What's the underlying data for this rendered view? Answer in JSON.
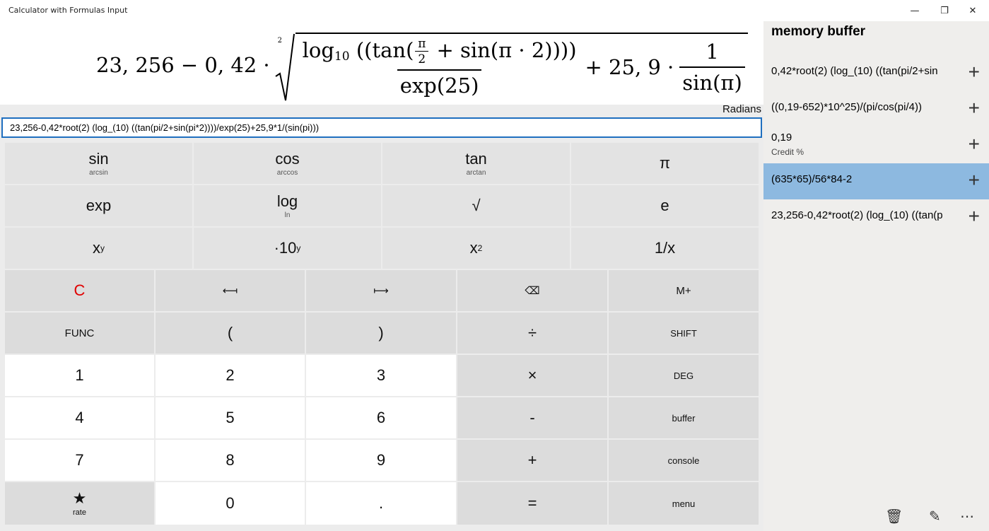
{
  "window": {
    "title": "Calculator with Formulas Input",
    "min": "—",
    "restore": "❐",
    "close": "✕"
  },
  "formula_render": {
    "a": "23, 256 − 0, 42 ·",
    "root_index": "2",
    "log": "log",
    "log_base": "10",
    "tan_part": "((tan(",
    "pi": "π",
    "two": "2",
    "sin_part": "+ sin(π · 2))))",
    "exp": "exp(25)",
    "plus": "+ 25, 9 ·",
    "one": "1",
    "sinpi": "sin(π)"
  },
  "mode": "Radians",
  "input_value": "23,256-0,42*root(2) (log_(10) ((tan(pi/2+sin(pi*2))))/exp(25)+25,9*1/(sin(pi)))",
  "keys": {
    "sin": "sin",
    "arcsin": "arcsin",
    "cos": "cos",
    "arccos": "arccos",
    "tan": "tan",
    "arctan": "arctan",
    "pi": "π",
    "exp": "exp",
    "log": "log",
    "ln": "ln",
    "sqrt": "√",
    "e": "e",
    "x": "x",
    "y": "y",
    "dot10": "·10",
    "x2": "x",
    "two": "2",
    "inv": "1/x",
    "clear": "C",
    "left": "⟻",
    "right": "⟼",
    "backspace": "⌫",
    "mplus": "M+",
    "func": "FUNC",
    "lparen": "(",
    "rparen": ")",
    "div": "÷",
    "shift": "SHIFT",
    "n1": "1",
    "n2": "2",
    "n3": "3",
    "mul": "×",
    "deg": "DEG",
    "n4": "4",
    "n5": "5",
    "n6": "6",
    "minus": "-",
    "buffer": "buffer",
    "n7": "7",
    "n8": "8",
    "n9": "9",
    "plus": "+",
    "console": "console",
    "star": "★",
    "rate": "rate",
    "n0": "0",
    "dot": ".",
    "eq": "=",
    "menu": "menu"
  },
  "memory": {
    "title": "memory buffer",
    "items": [
      {
        "text": "0,42*root(2) (log_(10) ((tan(pi/2+sin",
        "sub": ""
      },
      {
        "text": "((0,19-652)*10^25)/(pi/cos(pi/4))",
        "sub": ""
      },
      {
        "text": "0,19",
        "sub": "Credit %"
      },
      {
        "text": "(635*65)/56*84-2",
        "sub": ""
      },
      {
        "text": "23,256-0,42*root(2) (log_(10) ((tan(p",
        "sub": ""
      }
    ],
    "plus": "+",
    "selected_index": 3
  },
  "footer": {
    "delete": "🗑",
    "edit": "✎",
    "more": "⋯"
  }
}
